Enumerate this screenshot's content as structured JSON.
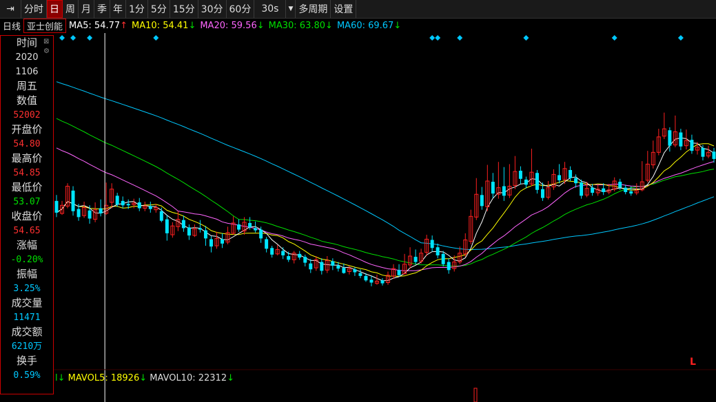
{
  "toolbar": {
    "pin_icon": "pin-icon",
    "items": [
      {
        "label": "分时",
        "active": false
      },
      {
        "label": "日",
        "active": true
      },
      {
        "label": "周",
        "active": false
      },
      {
        "label": "月",
        "active": false
      },
      {
        "label": "季",
        "active": false
      },
      {
        "label": "年",
        "active": false
      },
      {
        "label": "1分",
        "active": false
      },
      {
        "label": "5分",
        "active": false
      },
      {
        "label": "15分",
        "active": false
      },
      {
        "label": "30分",
        "active": false
      },
      {
        "label": "60分",
        "active": false
      },
      {
        "label": "30s",
        "active": false
      }
    ],
    "dropdown_icon": "▼",
    "multi_period": "多周期",
    "settings": "设置"
  },
  "ma_bar": {
    "period_label": "日线",
    "stock_name": "亚士创能",
    "ma": [
      {
        "label": "MA5: 54.77",
        "arrow": "↑",
        "color": "#ffffff",
        "arrow_color": "#ff3030"
      },
      {
        "label": "MA10: 54.41",
        "arrow": "↓",
        "color": "#ffff00",
        "arrow_color": "#00e000"
      },
      {
        "label": "MA20: 59.56",
        "arrow": "↓",
        "color": "#ff66ff",
        "arrow_color": "#00e000"
      },
      {
        "label": "MA30: 63.80",
        "arrow": "↓",
        "color": "#00e000",
        "arrow_color": "#00e000"
      },
      {
        "label": "MA60: 69.67",
        "arrow": "↓",
        "color": "#00c8ff",
        "arrow_color": "#00e000"
      }
    ]
  },
  "info_panel": {
    "time_label": "时间",
    "year": "2020",
    "date": "1106",
    "weekday": "周五",
    "value_label": "数值",
    "value": "52002",
    "open_label": "开盘价",
    "open": "54.80",
    "high_label": "最高价",
    "high": "54.85",
    "low_label": "最低价",
    "low": "53.07",
    "close_label": "收盘价",
    "close": "54.65",
    "change_label": "涨幅",
    "change": "-0.20%",
    "amplitude_label": "振幅",
    "amplitude": "3.25%",
    "volume_label": "成交量",
    "volume": "11471",
    "amount_label": "成交额",
    "amount": "6210万",
    "turnover_label": "换手",
    "turnover": "0.59%"
  },
  "volume_bar": {
    "prefix": "l↓",
    "mavol5": "MAVOL5: 18926",
    "mavol5_arrow": "↓",
    "mavol10": "MAVOL10: 22312",
    "mavol10_arrow": "↓"
  },
  "l_marker": "L",
  "colors": {
    "up": "#ff2020",
    "down": "#00e5ff",
    "ma5": "#ffffff",
    "ma10": "#ffff00",
    "ma20": "#ff66ff",
    "ma30": "#00e000",
    "ma60": "#00c8ff",
    "marker": "#00c8ff"
  },
  "chart_data": {
    "type": "candlestick",
    "candles": [
      [
        54.8,
        53.2,
        55.6,
        52.6
      ],
      [
        53.1,
        54.2,
        54.8,
        52.9
      ],
      [
        54.1,
        56.8,
        57.2,
        53.8
      ],
      [
        56.2,
        53.4,
        56.8,
        52.8
      ],
      [
        53.7,
        52.6,
        54.4,
        52.1
      ],
      [
        52.8,
        53.9,
        54.7,
        52.5
      ],
      [
        53.5,
        52.4,
        54.2,
        51.7
      ],
      [
        52.3,
        53.6,
        54.6,
        51.9
      ],
      [
        53.8,
        53.1,
        55.0,
        52.7
      ],
      [
        53.1,
        54.2,
        57.3,
        52.9
      ],
      [
        54.6,
        56.4,
        57.2,
        53.8
      ],
      [
        55.5,
        54.3,
        55.9,
        54.0
      ],
      [
        54.8,
        54.2,
        55.4,
        53.8
      ],
      [
        54.4,
        54.2,
        55.0,
        53.7
      ],
      [
        54.3,
        54.5,
        55.1,
        53.8
      ],
      [
        54.6,
        53.8,
        55.2,
        53.4
      ],
      [
        53.8,
        54.1,
        54.7,
        53.4
      ],
      [
        54.1,
        53.7,
        54.7,
        53.2
      ],
      [
        53.6,
        53.9,
        54.4,
        53.2
      ],
      [
        53.4,
        52.1,
        53.9,
        51.9
      ],
      [
        52.3,
        50.4,
        52.9,
        49.4
      ],
      [
        50.2,
        51.4,
        51.9,
        49.8
      ],
      [
        51.3,
        52.3,
        53.4,
        50.7
      ],
      [
        52.2,
        51.1,
        52.8,
        50.6
      ],
      [
        51.2,
        50.1,
        51.6,
        49.5
      ],
      [
        50.1,
        51.0,
        51.6,
        49.9
      ],
      [
        51.1,
        50.9,
        52.2,
        50.5
      ],
      [
        50.8,
        49.7,
        51.4,
        48.7
      ],
      [
        49.6,
        48.6,
        50.0,
        47.8
      ],
      [
        48.7,
        49.7,
        50.6,
        48.3
      ],
      [
        49.6,
        49.0,
        50.4,
        48.4
      ],
      [
        49.2,
        50.5,
        51.3,
        48.9
      ],
      [
        50.4,
        51.8,
        52.7,
        50.2
      ],
      [
        51.6,
        50.9,
        52.3,
        50.6
      ],
      [
        50.7,
        51.9,
        52.6,
        50.2
      ],
      [
        51.8,
        51.2,
        52.6,
        50.9
      ],
      [
        51.1,
        50.8,
        52.0,
        50.5
      ],
      [
        50.9,
        49.7,
        51.3,
        49.1
      ],
      [
        49.6,
        48.3,
        49.9,
        47.8
      ],
      [
        48.4,
        47.5,
        48.7,
        47.1
      ],
      [
        47.6,
        48.2,
        48.8,
        47.4
      ],
      [
        48.0,
        47.4,
        48.5,
        46.9
      ],
      [
        47.3,
        46.8,
        47.9,
        46.5
      ],
      [
        46.8,
        47.7,
        48.0,
        46.3
      ],
      [
        47.6,
        47.1,
        48.0,
        46.8
      ],
      [
        47.2,
        46.4,
        47.5,
        45.9
      ],
      [
        46.3,
        45.5,
        46.9,
        45.0
      ],
      [
        45.7,
        46.8,
        47.3,
        45.3
      ],
      [
        46.5,
        45.3,
        47.0,
        44.8
      ],
      [
        45.4,
        46.7,
        47.3,
        45.0
      ],
      [
        46.6,
        46.0,
        47.0,
        45.4
      ],
      [
        46.0,
        45.6,
        46.5,
        45.2
      ],
      [
        45.7,
        45.0,
        46.3,
        44.9
      ],
      [
        45.2,
        45.6,
        46.0,
        44.8
      ],
      [
        45.5,
        45.1,
        45.8,
        44.6
      ],
      [
        45.0,
        44.6,
        45.5,
        44.3
      ],
      [
        44.6,
        44.0,
        45.0,
        43.8
      ],
      [
        44.1,
        43.7,
        44.6,
        43.2
      ],
      [
        43.6,
        43.9,
        44.8,
        43.4
      ],
      [
        44.0,
        43.6,
        44.3,
        43.3
      ],
      [
        43.7,
        44.7,
        45.2,
        43.4
      ],
      [
        44.6,
        45.6,
        46.2,
        44.2
      ],
      [
        45.4,
        44.7,
        46.2,
        44.5
      ],
      [
        44.9,
        46.2,
        47.6,
        44.8
      ],
      [
        46.1,
        47.3,
        48.5,
        45.6
      ],
      [
        47.2,
        46.5,
        48.2,
        46.2
      ],
      [
        46.6,
        47.7,
        48.3,
        46.3
      ],
      [
        47.8,
        49.6,
        50.2,
        47.3
      ],
      [
        49.5,
        48.4,
        50.1,
        47.9
      ],
      [
        48.5,
        47.4,
        49.0,
        47.0
      ],
      [
        47.6,
        46.2,
        48.0,
        45.9
      ],
      [
        46.5,
        45.4,
        47.0,
        44.9
      ],
      [
        45.6,
        46.5,
        47.4,
        45.2
      ],
      [
        46.5,
        47.7,
        48.6,
        46.2
      ],
      [
        47.6,
        49.5,
        50.4,
        47.2
      ],
      [
        49.3,
        52.7,
        53.6,
        48.9
      ],
      [
        52.6,
        55.7,
        57.9,
        52.2
      ],
      [
        55.6,
        54.1,
        56.7,
        53.6
      ],
      [
        54.0,
        57.5,
        59.7,
        53.4
      ],
      [
        57.4,
        55.8,
        58.6,
        55.2
      ],
      [
        55.7,
        56.6,
        60.1,
        55.1
      ],
      [
        56.8,
        55.5,
        59.4,
        54.8
      ],
      [
        55.6,
        56.8,
        59.8,
        55.2
      ],
      [
        56.9,
        58.8,
        60.9,
        56.4
      ],
      [
        58.9,
        57.8,
        59.5,
        57.1
      ],
      [
        57.7,
        57.0,
        58.1,
        56.5
      ],
      [
        57.1,
        58.7,
        61.9,
        56.8
      ],
      [
        58.6,
        56.3,
        59.0,
        55.8
      ],
      [
        56.4,
        55.2,
        57.3,
        54.8
      ],
      [
        55.3,
        56.6,
        57.5,
        55.0
      ],
      [
        56.7,
        58.4,
        59.1,
        56.3
      ],
      [
        58.3,
        57.6,
        59.8,
        57.2
      ],
      [
        57.7,
        59.2,
        60.1,
        57.1
      ],
      [
        59.0,
        57.9,
        59.5,
        57.5
      ],
      [
        57.9,
        57.2,
        58.4,
        56.6
      ],
      [
        57.3,
        55.5,
        57.7,
        55.1
      ],
      [
        55.6,
        56.5,
        57.4,
        55.3
      ],
      [
        56.6,
        55.9,
        57.1,
        55.5
      ],
      [
        55.9,
        56.4,
        57.0,
        55.5
      ],
      [
        56.5,
        56.0,
        57.2,
        55.6
      ],
      [
        56.0,
        56.3,
        57.1,
        55.7
      ],
      [
        56.4,
        57.5,
        58.0,
        56.1
      ],
      [
        57.4,
        56.6,
        57.8,
        56.3
      ],
      [
        56.6,
        56.0,
        57.0,
        55.7
      ],
      [
        56.1,
        55.8,
        56.8,
        55.5
      ],
      [
        55.9,
        56.2,
        57.2,
        55.6
      ],
      [
        56.3,
        57.4,
        60.2,
        56.1
      ],
      [
        57.6,
        59.8,
        61.6,
        57.3
      ],
      [
        59.7,
        61.4,
        63.0,
        59.2
      ],
      [
        61.4,
        63.5,
        64.6,
        61.0
      ],
      [
        63.6,
        64.6,
        66.8,
        63.2
      ],
      [
        64.4,
        62.3,
        64.8,
        61.5
      ],
      [
        62.4,
        64.2,
        66.4,
        62.1
      ],
      [
        64.1,
        62.2,
        64.6,
        61.7
      ],
      [
        62.3,
        63.0,
        64.5,
        61.8
      ],
      [
        63.1,
        61.6,
        63.8,
        61.2
      ],
      [
        61.7,
        62.1,
        62.8,
        61.1
      ],
      [
        62.0,
        60.8,
        62.4,
        60.3
      ],
      [
        60.9,
        61.4,
        62.3,
        60.6
      ],
      [
        61.5,
        60.5,
        62.0,
        60.0
      ]
    ],
    "ma5_end": 54.77,
    "ma10_end": 54.41,
    "ma20_end": 59.56,
    "ma30_end": 63.8,
    "ma60_end": 69.67,
    "selected_index": 9,
    "selected_candle": {
      "open": 54.8,
      "high": 54.85,
      "low": 53.07,
      "close": 54.65
    },
    "markers": [
      1,
      3,
      6,
      18,
      68,
      69,
      73,
      85,
      101,
      113
    ]
  }
}
